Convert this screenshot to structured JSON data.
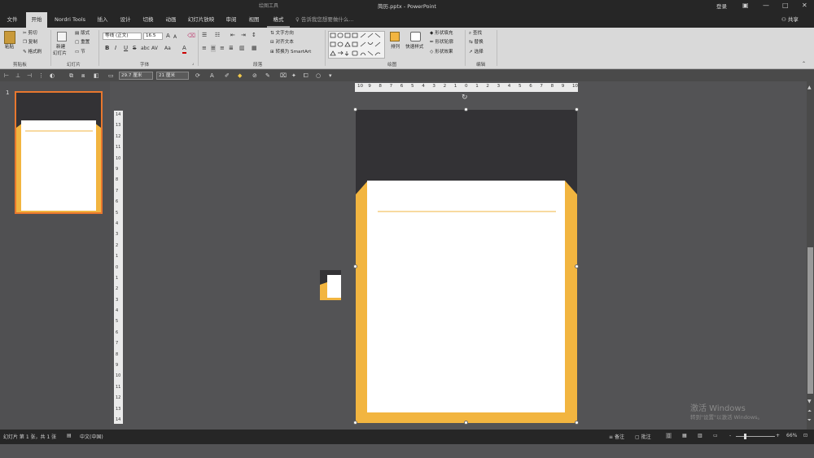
{
  "titlebar": {
    "title": "简历.pptx - PowerPoint",
    "context": "绘图工具",
    "login": "登录",
    "minimize": "—",
    "maximize": "□",
    "close": "✕"
  },
  "tabs": [
    "文件",
    "开始",
    "Nordri Tools",
    "插入",
    "设计",
    "切换",
    "动画",
    "幻灯片放映",
    "审阅",
    "视图",
    "格式"
  ],
  "active_tab": "开始",
  "tellme": "告诉我您想要做什么...",
  "share": "共享",
  "ribbon": {
    "clipboard": {
      "paste": "粘贴",
      "cut": "剪切",
      "copy": "复制",
      "format_painter": "格式刷",
      "label": "剪贴板"
    },
    "slides": {
      "new_slide": "新建",
      "new_slide2": "幻灯片",
      "layout": "版式",
      "reset": "重置",
      "section": "节",
      "label": "幻灯片"
    },
    "font": {
      "name": "等线 (正文)",
      "size": "16.5",
      "label": "字体",
      "bold": "B",
      "italic": "I",
      "underline": "U",
      "strike": "S",
      "shadow": "abc",
      "spacing": "AV",
      "case": "Aa",
      "color": "A",
      "grow": "A",
      "shrink": "A"
    },
    "paragraph": {
      "text_direction": "文字方向",
      "align_text": "对齐文本",
      "smartart": "转换为 SmartArt",
      "label": "段落"
    },
    "drawing": {
      "arrange": "排列",
      "quick_styles": "快速样式",
      "fill": "形状填充",
      "outline": "形状轮廓",
      "effects": "形状效果",
      "label": "绘图"
    },
    "editing": {
      "find": "查找",
      "replace": "替换",
      "select": "选择",
      "label": "编辑"
    }
  },
  "format_bar": {
    "width": "29.7 厘米",
    "height": "21 厘米"
  },
  "slides_panel": {
    "number": "1"
  },
  "ruler": {
    "h": [
      "10",
      "9",
      "8",
      "7",
      "6",
      "5",
      "4",
      "3",
      "2",
      "1",
      "0",
      "1",
      "2",
      "3",
      "4",
      "5",
      "6",
      "7",
      "8",
      "9",
      "10"
    ],
    "v": [
      "14",
      "13",
      "12",
      "11",
      "10",
      "9",
      "8",
      "7",
      "6",
      "5",
      "4",
      "3",
      "2",
      "1",
      "0",
      "1",
      "2",
      "3",
      "4",
      "5",
      "6",
      "7",
      "8",
      "9",
      "10",
      "11",
      "12",
      "13",
      "14"
    ]
  },
  "status": {
    "slide_info": "幻灯片 第 1 张，共 1 张",
    "language": "中文(中国)",
    "notes": "备注",
    "comments": "批注",
    "zoom": "66%",
    "minus": "-",
    "plus": "+"
  },
  "watermark": {
    "line1": "激活 Windows",
    "line2": "转到\"设置\"以激活 Windows。"
  },
  "colors": {
    "accent": "#f2b540",
    "dark": "#333235",
    "thumb_border": "#e8772e"
  }
}
